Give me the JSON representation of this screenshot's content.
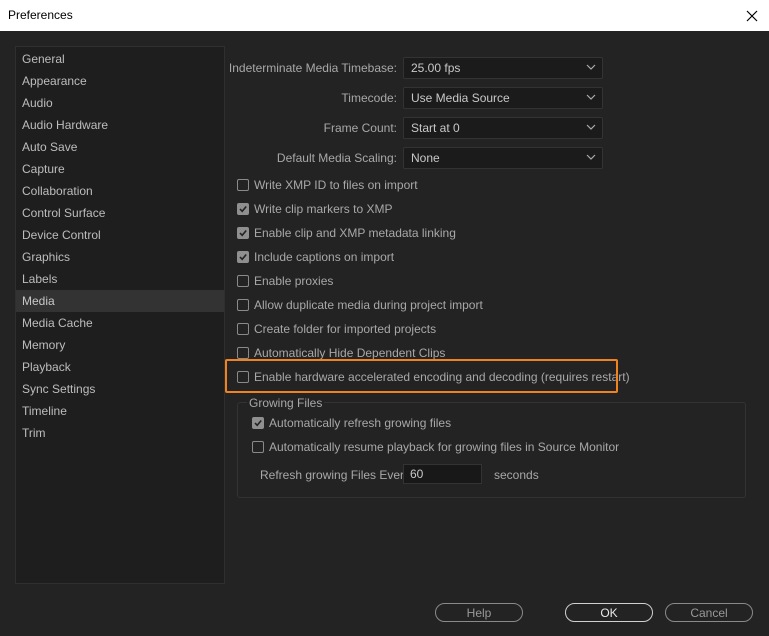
{
  "window": {
    "title": "Preferences",
    "close_icon": "close-icon"
  },
  "sidebar": {
    "items": [
      {
        "label": "General"
      },
      {
        "label": "Appearance"
      },
      {
        "label": "Audio"
      },
      {
        "label": "Audio Hardware"
      },
      {
        "label": "Auto Save"
      },
      {
        "label": "Capture"
      },
      {
        "label": "Collaboration"
      },
      {
        "label": "Control Surface"
      },
      {
        "label": "Device Control"
      },
      {
        "label": "Graphics"
      },
      {
        "label": "Labels"
      },
      {
        "label": "Media"
      },
      {
        "label": "Media Cache"
      },
      {
        "label": "Memory"
      },
      {
        "label": "Playback"
      },
      {
        "label": "Sync Settings"
      },
      {
        "label": "Timeline"
      },
      {
        "label": "Trim"
      }
    ],
    "selected": "Media"
  },
  "dropdowns": [
    {
      "label": "Indeterminate Media Timebase:",
      "value": "25.00 fps"
    },
    {
      "label": "Timecode:",
      "value": "Use Media Source"
    },
    {
      "label": "Frame Count:",
      "value": "Start at 0"
    },
    {
      "label": "Default Media Scaling:",
      "value": "None"
    }
  ],
  "checkboxes": [
    {
      "label": "Write XMP ID to files on import",
      "checked": false
    },
    {
      "label": "Write clip markers to XMP",
      "checked": true
    },
    {
      "label": "Enable clip and XMP metadata linking",
      "checked": true
    },
    {
      "label": "Include captions on import",
      "checked": true
    },
    {
      "label": "Enable proxies",
      "checked": false
    },
    {
      "label": "Allow duplicate media during project import",
      "checked": false
    },
    {
      "label": "Create folder for imported projects",
      "checked": false
    },
    {
      "label": "Automatically Hide Dependent Clips",
      "checked": false
    },
    {
      "label": "Enable hardware accelerated encoding and decoding (requires restart)",
      "checked": false
    }
  ],
  "highlight_color": "#f0821f",
  "growing_files": {
    "title": "Growing Files",
    "checkboxes": [
      {
        "label": "Automatically refresh growing files",
        "checked": true
      },
      {
        "label": "Automatically resume playback for growing files in Source Monitor",
        "checked": false
      }
    ],
    "refresh_label": "Refresh growing Files Every",
    "refresh_value": "60",
    "refresh_unit": "seconds"
  },
  "buttons": {
    "help": "Help",
    "ok": "OK",
    "cancel": "Cancel"
  }
}
